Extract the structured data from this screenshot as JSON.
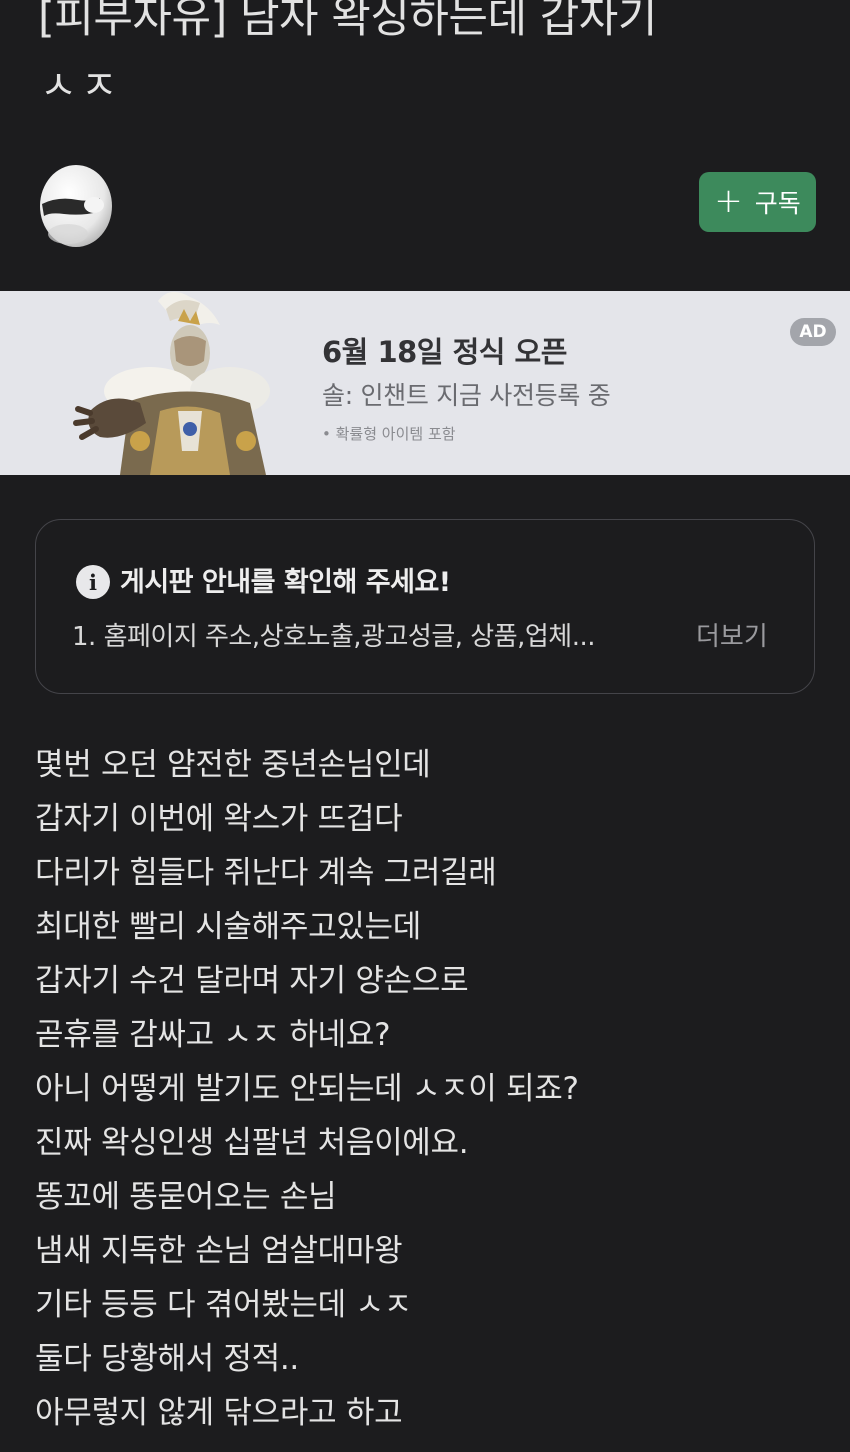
{
  "post": {
    "title_line1": "[피부자유] 남자 왁싱하는데 갑자기",
    "title_line2": "ㅅㅈ"
  },
  "author": {
    "avatar_icon": "avatar-egg-icon"
  },
  "subscribe": {
    "label": "구독",
    "icon": "plus-icon",
    "color": "#3d8a5c"
  },
  "ad": {
    "headline": "6월 18일 정식 오픈",
    "subtitle": "솔: 인챈트 지금 사전등록 중",
    "note": "• 확률형 아이템 포함",
    "badge": "AD"
  },
  "notice": {
    "title": "게시판 안내를 확인해 주세요!",
    "text": "1. 홈페이지 주소,상호노출,광고성글, 상품,업체...",
    "more_label": "더보기"
  },
  "body_lines": [
    "몇번 오던 얌전한 중년손님인데",
    "갑자기 이번에 왁스가 뜨겁다",
    "다리가 힘들다 쥐난다 계속 그러길래",
    "최대한 빨리 시술해주고있는데",
    "갑자기 수건 달라며 자기 양손으로",
    "곧휴를 감싸고 ㅅㅈ 하네요?",
    "아니 어떻게 발기도 안되는데 ㅅㅈ이 되죠?",
    "진짜 왁싱인생 십팔년 처음이에요.",
    "똥꼬에 똥묻어오는 손님",
    "냄새 지독한 손님 엄살대마왕",
    "기타 등등 다 겪어봤는데 ㅅㅈ",
    "둘다 당황해서 정적..",
    "아무렇지 않게 닦으라고 하고"
  ]
}
